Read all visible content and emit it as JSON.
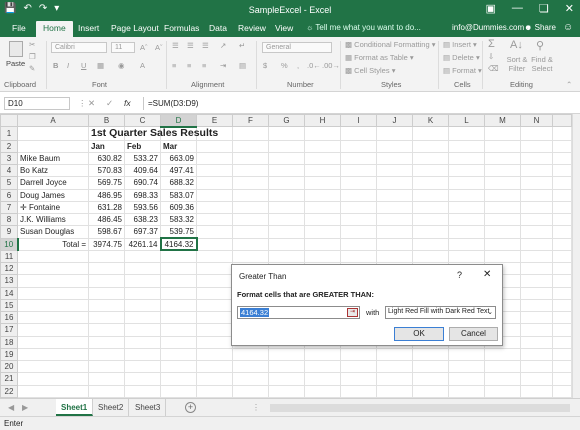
{
  "title_bar": {
    "document_title": "SampleExcel - Excel",
    "quick_access": [
      "save-icon",
      "undo-icon",
      "redo-icon",
      "customize-icon"
    ],
    "window_buttons": [
      "minimize-icon",
      "restore-icon",
      "close-icon"
    ]
  },
  "ribbon_tabs": [
    "File",
    "Home",
    "Insert",
    "Page Layout",
    "Formulas",
    "Data",
    "Review",
    "View"
  ],
  "tell_me": "Tell me what you want to do...",
  "account": "info@Dummies.com",
  "share": "Share",
  "ribbon": {
    "groups": [
      "Clipboard",
      "Font",
      "Alignment",
      "Number",
      "Styles",
      "Cells",
      "Editing"
    ],
    "paste": "Paste",
    "font_name": "Calibri",
    "font_size": "11",
    "number_format": "General",
    "conditional_formatting": "Conditional Formatting",
    "format_as_table": "Format as Table",
    "cell_styles": "Cell Styles",
    "insert": "Insert",
    "delete": "Delete",
    "format": "Format",
    "sort_filter": "Sort & Filter",
    "find_select": "Find & Select",
    "bold": "B",
    "italic": "I",
    "underline": "U",
    "dollar": "$",
    "percent": "%",
    "comma": ","
  },
  "formula_bar": {
    "name_box": "D10",
    "cancel": "✕",
    "enter": "✓",
    "fx": "fx",
    "formula": "=SUM(D3:D9)"
  },
  "columns": [
    "A",
    "B",
    "C",
    "D",
    "E",
    "F",
    "G",
    "H",
    "I",
    "J",
    "K",
    "L",
    "M",
    "N"
  ],
  "rows": [
    "1",
    "2",
    "3",
    "4",
    "5",
    "6",
    "7",
    "8",
    "9",
    "10",
    "11",
    "12",
    "13",
    "14",
    "15",
    "16",
    "17",
    "18",
    "19",
    "20",
    "21",
    "22"
  ],
  "sheet": {
    "title": "1st Quarter Sales Results",
    "headers": [
      "Jan",
      "Feb",
      "Mar"
    ],
    "data": [
      {
        "name": "Mike Baum",
        "jan": "630.82",
        "feb": "533.27",
        "mar": "663.09"
      },
      {
        "name": "Bo Katz",
        "jan": "570.83",
        "feb": "409.64",
        "mar": "497.41"
      },
      {
        "name": "Darrell Joyce",
        "jan": "569.75",
        "feb": "690.74",
        "mar": "688.32"
      },
      {
        "name": "Doug James",
        "jan": "486.95",
        "feb": "698.33",
        "mar": "583.07"
      },
      {
        "name": "Fontaine",
        "jan": "631.28",
        "feb": "593.56",
        "mar": "609.36"
      },
      {
        "name": "J.K. Williams",
        "jan": "486.45",
        "feb": "638.23",
        "mar": "583.32"
      },
      {
        "name": "Susan Douglas",
        "jan": "598.67",
        "feb": "697.37",
        "mar": "539.75"
      }
    ],
    "total": {
      "label": "Total =",
      "jan": "3974.75",
      "feb": "4261.14",
      "mar": "4164.32"
    }
  },
  "dialog": {
    "title": "Greater Than",
    "help": "?",
    "close": "✕",
    "label": "Format cells that are GREATER THAN:",
    "value": "4164.32",
    "with_label": "with",
    "format_option": "Light Red Fill with Dark Red Text",
    "ok": "OK",
    "cancel": "Cancel"
  },
  "sheet_tabs": [
    "Sheet1",
    "Sheet2",
    "Sheet3"
  ],
  "active_sheet": "Sheet1",
  "status": "Enter",
  "accent_color": "#217346"
}
